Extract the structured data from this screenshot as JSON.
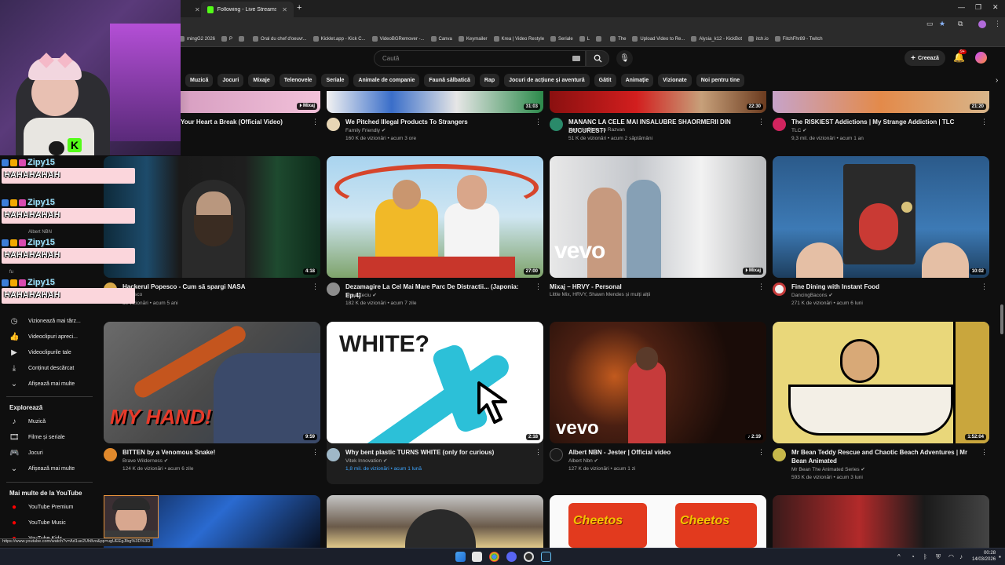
{
  "browser": {
    "active_tab": "Following - Live Streams on Ki",
    "bookmarks": [
      "mingG2 2026",
      "P",
      "",
      "Oral du chef d'oeuvr...",
      "Kicklet.app - Kick C...",
      "VideoBGRemover -...",
      "Canva",
      "Keymailer",
      "Krea | Video Restyle",
      "Seriale",
      "L",
      "",
      "The",
      "Upload Video to Re...",
      "Alysia_k12 - KickBot",
      "itch.io",
      "FitchFhr89 - Twitch"
    ],
    "status_url": "https://www.youtube.com/watch?v=Ad1ue2Uh8vo&pp=ugUEEgJlbg%3D%3D"
  },
  "header": {
    "search_placeholder": "Caută",
    "create_label": "Creează",
    "notif_badge": "9+"
  },
  "chips": [
    "Muzică",
    "Jocuri",
    "Mixaje",
    "Telenovele",
    "Seriale",
    "Animale de companie",
    "Faună sălbatică",
    "Rap",
    "Jocuri de acțiune și aventură",
    "Gătit",
    "Animație",
    "Vizionate",
    "Noi pentru tine"
  ],
  "sidebar": {
    "you_items": [
      {
        "icon": "clock-icon",
        "label": "Vizionează mai târz..."
      },
      {
        "icon": "thumbs-up-icon",
        "label": "Videoclipuri apreci..."
      },
      {
        "icon": "video-icon",
        "label": "Videoclipurile tale"
      },
      {
        "icon": "download-icon",
        "label": "Conținut descărcat"
      },
      {
        "icon": "chevron-down-icon",
        "label": "Afișează mai multe"
      }
    ],
    "explore_title": "Explorează",
    "explore_items": [
      {
        "icon": "music-icon",
        "label": "Muzică"
      },
      {
        "icon": "film-icon",
        "label": "Filme și seriale"
      },
      {
        "icon": "gamepad-icon",
        "label": "Jocuri"
      },
      {
        "icon": "chevron-down-icon",
        "label": "Afișează mai multe"
      }
    ],
    "more_title": "Mai multe de la YouTube",
    "more_items": [
      {
        "icon": "youtube-premium-icon",
        "label": "YouTube Premium"
      },
      {
        "icon": "youtube-music-icon",
        "label": "YouTube Music"
      },
      {
        "icon": "youtube-kids-icon",
        "label": "YouTube Kids"
      }
    ]
  },
  "top_row": [
    {
      "title": "Your Heart a Break (Official Video)",
      "channel": "",
      "stats": "",
      "duration": "",
      "badge": "Mixaj"
    },
    {
      "title": "We Pitched Illegal Products To Strangers",
      "channel": "Family Friendly",
      "stats": "160 K de vizionări • acum 3 ore",
      "duration": "31:03"
    },
    {
      "title": "MANANC LA CELE MAI INSALUBRE SHAORMERII DIN BUCURESTI",
      "channel": "Nota de Plata cu Razvan",
      "stats": "51 K de vizionări • acum 2 săptămâni",
      "duration": "22:30"
    },
    {
      "title": "The RISKIEST Addictions | My Strange Addiction | TLC",
      "channel": "TLC",
      "stats": "9,3 mil. de vizionări • acum 1 an",
      "duration": "21:20"
    }
  ],
  "row2": [
    {
      "title": "Hackerul Popesco - Cum să spargi NASA",
      "channel": "Popesco",
      "stats": "de vizionări • acum 5 ani",
      "duration": "4:18"
    },
    {
      "title": "Dezamagire La Cel Mai Mare Parc De Distractii... (Japonia: Ep.4)",
      "channel": "Theo Zeciu",
      "stats": "182 K de vizionări • acum 7 zile",
      "duration": "27:00"
    },
    {
      "title": "Mixaj – HRVY - Personal",
      "channel": "Little Mix, HRVY, Shawn Mendes și mulți alții",
      "stats": "",
      "duration": "",
      "badge": "Mixaj"
    },
    {
      "title": "Fine Dining with Instant Food",
      "channel": "DancingBacons",
      "stats": "271 K de vizionări • acum 6 luni",
      "duration": "10:02"
    }
  ],
  "row3": [
    {
      "title": "BITTEN by a Venomous Snake!",
      "channel": "Brave Wilderness",
      "stats": "124 K de vizionări • acum 6 zile",
      "duration": "9:59"
    },
    {
      "title": "Why bent plastic TURNS WHITE (only for curious)",
      "channel": "Vitek Innovation",
      "stats": "1,8 mil. de vizionări • acum 1 lună",
      "duration": "2:18"
    },
    {
      "title": "Albert NBN - Jester | Official video",
      "channel": "Albert Nbn",
      "stats": "127 K de vizionări • acum 1 zi",
      "duration": "2:19"
    },
    {
      "title": "Mr Bean Teddy Rescue and Chaotic Beach Adventures | Mr Bean Animated",
      "channel": "Mr Bean The Animated Series",
      "stats": "593 K de vizionări • acum 3 luni",
      "duration": "1:52:04"
    }
  ],
  "thumb_text": {
    "white": "WHITE?",
    "hand": "MY HAND!",
    "vevo": "vevo",
    "cheetos": "Cheetos"
  },
  "chat": {
    "name": "Zipy15",
    "message": "HAHAHAHAH"
  },
  "chat_under": {
    "line1": "Albert NBN",
    "line2": "fu"
  },
  "clock": {
    "time": "00:28",
    "date": "14/03/2026"
  },
  "colors": {
    "bg": "#0f0f0f",
    "accent": "#ff0000",
    "kick": "#53fc18",
    "chat_bar": "#fbd6dc"
  }
}
